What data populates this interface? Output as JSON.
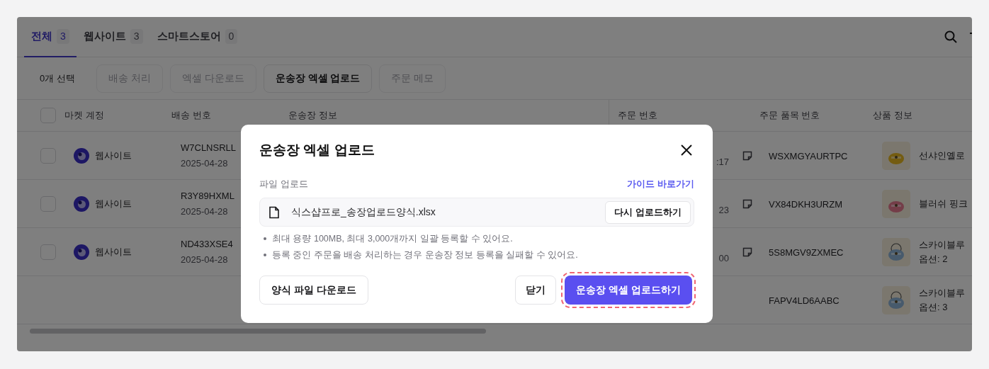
{
  "tabs": [
    {
      "label": "전체",
      "count": "3",
      "selected": true
    },
    {
      "label": "웹사이트",
      "count": "3",
      "selected": false
    },
    {
      "label": "스마트스토어",
      "count": "0",
      "selected": false
    }
  ],
  "toolbar": {
    "selection": "0개 선택",
    "buttons": [
      {
        "label": "배송 처리",
        "disabled": true
      },
      {
        "label": "엑셀 다운로드",
        "disabled": true
      },
      {
        "label": "운송장 엑셀 업로드",
        "disabled": false
      },
      {
        "label": "주문 메모",
        "disabled": true
      }
    ]
  },
  "table": {
    "header_checked": false,
    "columns": [
      "마켓 계정",
      "배송 번호",
      "운송장 정보",
      "주문 번호",
      "주문 품목 번호",
      "상품 정보"
    ],
    "rows": [
      {
        "checked": false,
        "market": "웹사이트",
        "delivery_no": "W7CLNSRLL",
        "date": "2025-04-28",
        "time": ":17",
        "memo": true,
        "item_no": "WSXMGYAURTPC",
        "product": "선샤인옐로",
        "option": ""
      },
      {
        "checked": false,
        "market": "웹사이트",
        "delivery_no": "R3Y89HXML",
        "date": "2025-04-28",
        "time": "23",
        "memo": true,
        "item_no": "VX84DKH3URZM",
        "product": "블러쉬 핑크",
        "option": ""
      },
      {
        "checked": false,
        "market": "웹사이트",
        "delivery_no": "ND433XSE4",
        "date": "2025-04-28",
        "time": "00",
        "memo": true,
        "item_no": "5S8MGV9ZXMEC",
        "product": "스카이블루",
        "option": "옵션: 2"
      },
      {
        "checked": null,
        "market": "",
        "delivery_no": "",
        "date": "",
        "time": "",
        "memo": false,
        "item_no": "FAPV4LD6AABC",
        "product": "스카이블루",
        "option": "옵션: 3"
      }
    ]
  },
  "modal": {
    "title": "운송장 엑셀 업로드",
    "file_label": "파일 업로드",
    "guide_link": "가이드 바로가기",
    "file_name": "식스샵프로_송장업로드양식.xlsx",
    "reupload": "다시 업로드하기",
    "notes": [
      "최대 용량 100MB, 최대 3,000개까지 일괄 등록할 수 있어요.",
      "등록 중인 주문을 배송 처리하는 경우 운송장 정보 등록을 실패할 수 있어요."
    ],
    "template_button": "양식 파일 다운로드",
    "close_button": "닫기",
    "submit_button": "운송장 엑셀 업로드하기",
    "submit_focused": true
  }
}
